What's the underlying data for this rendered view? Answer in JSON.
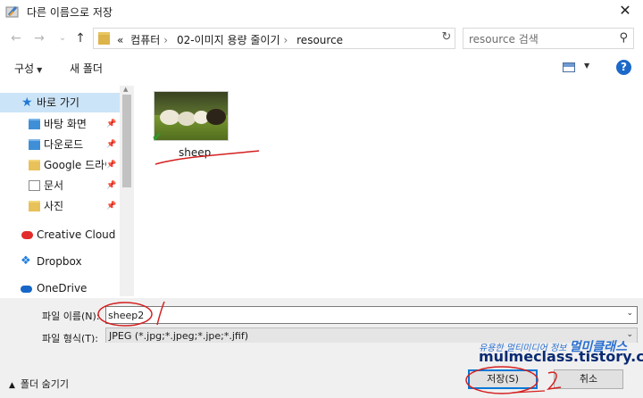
{
  "window": {
    "title": "다른 이름으로 저장",
    "close_label": "✕"
  },
  "nav": {
    "back_label": "←",
    "forward_label": "→",
    "recent_label": "⌄",
    "up_label": "↑",
    "breadcrumb": [
      "«",
      "컴퓨터",
      "02-이미지 용량 줄이기",
      "resource"
    ],
    "refresh_label": "↻",
    "search_placeholder": "resource 검색"
  },
  "toolbar": {
    "organize_label": "구성",
    "new_folder_label": "새 폴더",
    "help_label": "?"
  },
  "sidebar": {
    "items": [
      {
        "label": "바로 가기",
        "icon": "star-icon",
        "selected": true
      },
      {
        "label": "바탕 화면",
        "icon": "folder-icon",
        "pinned": true
      },
      {
        "label": "다운로드",
        "icon": "download-folder-icon",
        "pinned": true
      },
      {
        "label": "Google 드라이브",
        "icon": "folder-icon",
        "pinned": true
      },
      {
        "label": "문서",
        "icon": "document-icon",
        "pinned": true
      },
      {
        "label": "사진",
        "icon": "folder-icon",
        "pinned": true
      },
      {
        "label": "Creative Cloud Files",
        "icon": "creative-cloud-icon"
      },
      {
        "label": "Dropbox",
        "icon": "dropbox-icon"
      },
      {
        "label": "OneDrive",
        "icon": "onedrive-icon"
      }
    ]
  },
  "files": [
    {
      "name": "sheep",
      "icon": "image-thumbnail",
      "synced": true
    }
  ],
  "form": {
    "filename_label": "파일 이름(N):",
    "filename_value": "sheep2",
    "filetype_label": "파일 형식(T):",
    "filetype_value": "JPEG (*.jpg;*.jpeg;*.jpe;*.jfif)"
  },
  "footer": {
    "hide_folders_label": "폴더 숨기기",
    "save_label": "저장(S)",
    "cancel_label": "취소"
  },
  "watermark": {
    "tagline": "유용한 멀티미디어 정보",
    "brand": "멀미클래스",
    "url": "mulmeclass.tistory.com"
  },
  "colors": {
    "accent": "#0078d7",
    "selection": "#cce4f7",
    "annotation_red": "#d42020",
    "panel_bg": "#f0f0f0"
  }
}
